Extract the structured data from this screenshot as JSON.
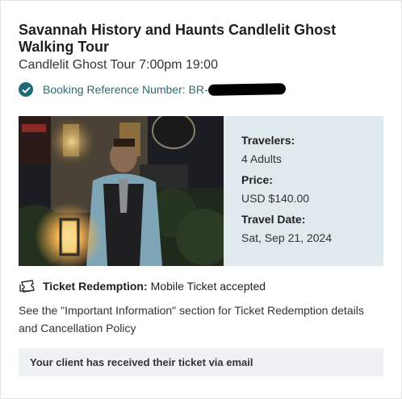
{
  "tour": {
    "title": "Savannah History and Haunts Candlelit Ghost Walking Tour",
    "subtitle": "Candlelit Ghost Tour 7:00pm 19:00"
  },
  "booking": {
    "label": "Booking Reference Number: BR-"
  },
  "details": {
    "travelers_label": "Travelers:",
    "travelers_value": "4 Adults",
    "price_label": "Price:",
    "price_value": "USD $140.00",
    "date_label": "Travel Date:",
    "date_value": "Sat, Sep 21, 2024"
  },
  "redemption": {
    "label": "Ticket Redemption:",
    "value": "Mobile Ticket accepted"
  },
  "info_text": "See the \"Important Information\" section for Ticket Redemption details and Cancellation Policy",
  "notice_text": "Your client has received their ticket via email",
  "colors": {
    "accent": "#1f6a78",
    "details_bg": "#e0eaee",
    "notice_bg": "#eef2f3"
  }
}
